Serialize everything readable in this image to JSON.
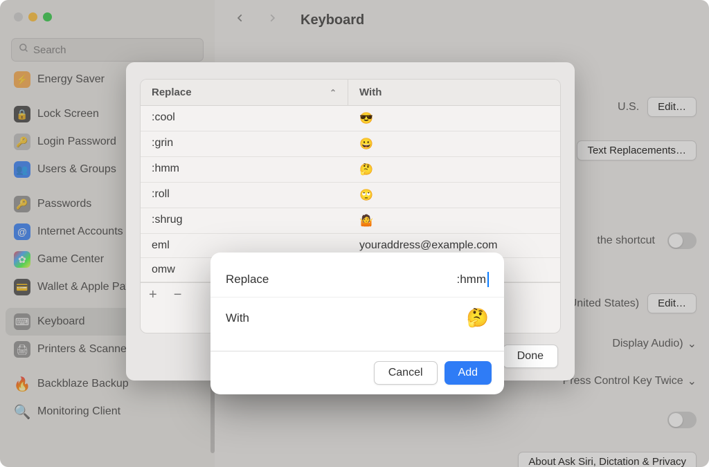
{
  "window": {
    "search_placeholder": "Search",
    "title": "Keyboard"
  },
  "sidebar": {
    "items": [
      {
        "label": "Energy Saver",
        "icon": "energy-icon",
        "iconClass": "orange"
      },
      {
        "label": "Lock Screen",
        "icon": "lock-screen-icon",
        "iconClass": "black"
      },
      {
        "label": "Login Password",
        "icon": "login-password-icon",
        "iconClass": "lgray"
      },
      {
        "label": "Users & Groups",
        "icon": "users-groups-icon",
        "iconClass": "blue"
      },
      {
        "label": "Passwords",
        "icon": "passwords-icon",
        "iconClass": "gray"
      },
      {
        "label": "Internet Accounts",
        "icon": "internet-accounts-icon",
        "iconClass": "teal"
      },
      {
        "label": "Game Center",
        "icon": "game-center-icon",
        "iconClass": "multi"
      },
      {
        "label": "Wallet & Apple Pay",
        "icon": "wallet-icon",
        "iconClass": "dark"
      },
      {
        "label": "Keyboard",
        "icon": "keyboard-icon",
        "iconClass": "gray",
        "selected": true
      },
      {
        "label": "Printers & Scanners",
        "icon": "printers-icon",
        "iconClass": "gray"
      },
      {
        "label": "Backblaze Backup",
        "icon": "backblaze-icon",
        "iconClass": "red"
      },
      {
        "label": "Monitoring Client",
        "icon": "monitoring-icon",
        "iconClass": "green"
      }
    ]
  },
  "right": {
    "lang": "U.S.",
    "edit": "Edit…",
    "replacements": "Text Replacements…",
    "shortcut_label": "the shortcut",
    "region_label": "United States)",
    "display_label": "Display Audio)",
    "press_label": "Press Control Key Twice",
    "about_label": "About Ask Siri, Dictation & Privacy"
  },
  "sheet": {
    "header_replace": "Replace",
    "header_with": "With",
    "rows": [
      {
        "replace": ":cool",
        "with": "😎"
      },
      {
        "replace": ":grin",
        "with": "😀"
      },
      {
        "replace": ":hmm",
        "with": "🤔"
      },
      {
        "replace": ":roll",
        "with": "🙄"
      },
      {
        "replace": ":shrug",
        "with": "🤷"
      },
      {
        "replace": "eml",
        "with": "youraddress@example.com"
      },
      {
        "replace": "omw",
        "with": ""
      }
    ],
    "done": "Done",
    "add_btn": "+",
    "remove_btn": "−"
  },
  "modal": {
    "replace_label": "Replace",
    "replace_value": ":hmm",
    "with_label": "With",
    "with_value": "🤔",
    "cancel": "Cancel",
    "add": "Add"
  }
}
